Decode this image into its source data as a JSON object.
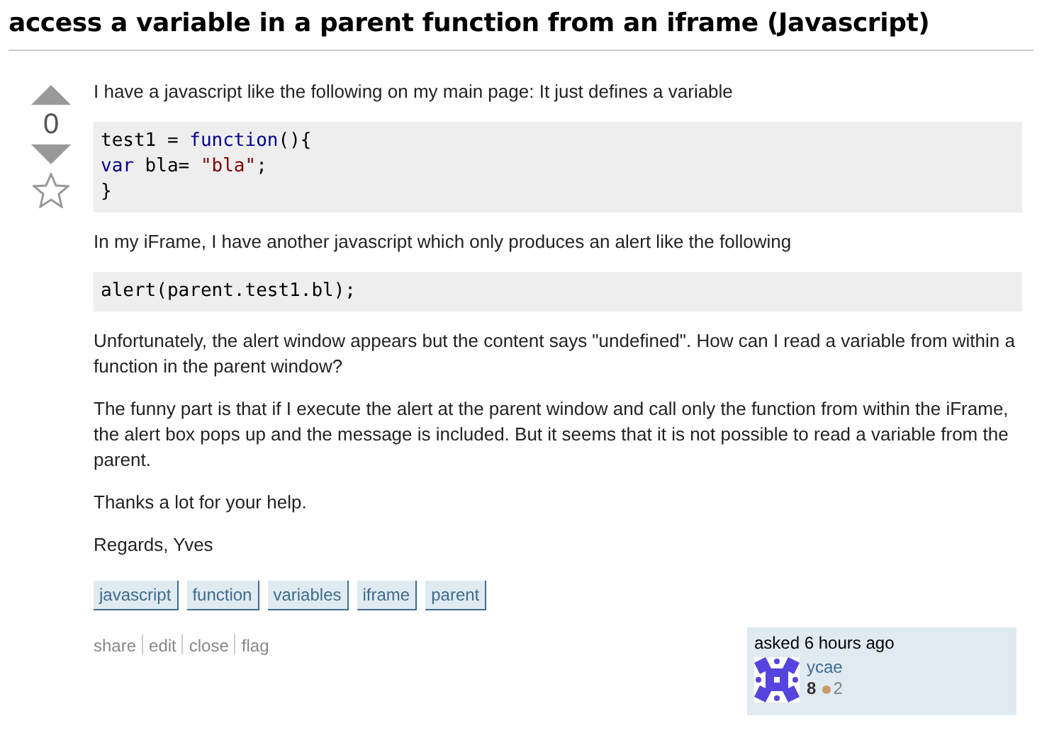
{
  "question": {
    "title": "access a variable in a parent function from an iframe (Javascript)",
    "votes": {
      "score": "0",
      "favorited": false
    },
    "body": [
      {
        "kind": "text",
        "text": "I have a javascript like the following on my main page: It just defines a variable"
      },
      {
        "kind": "code",
        "lines": [
          [
            {
              "text": "test1 = ",
              "kind": "plain"
            },
            {
              "text": "function",
              "kind": "keyword"
            },
            {
              "text": "(){",
              "kind": "plain"
            }
          ],
          [
            {
              "text": "var",
              "kind": "keyword"
            },
            {
              "text": " bla= ",
              "kind": "plain"
            },
            {
              "text": "\"bla\"",
              "kind": "string"
            },
            {
              "text": ";",
              "kind": "plain"
            }
          ],
          [
            {
              "text": "}",
              "kind": "plain"
            }
          ]
        ]
      },
      {
        "kind": "text",
        "text": "In my iFrame, I have another javascript which only produces an alert like the following"
      },
      {
        "kind": "code",
        "lines": [
          [
            {
              "text": "alert(parent.test1.bl);",
              "kind": "plain"
            }
          ]
        ]
      },
      {
        "kind": "text",
        "text": "Unfortunately, the alert window appears but the content says \"undefined\". How can I read a variable from within a function in the parent window?"
      },
      {
        "kind": "text",
        "text": "The funny part is that if I execute the alert at the parent window and call only the function from within the iFrame, the alert box pops up and the message is included. But it seems that it is not possible to read a variable from the parent."
      },
      {
        "kind": "text",
        "text": "Thanks a lot for your help."
      },
      {
        "kind": "text",
        "text": "Regards, Yves"
      }
    ],
    "tags": [
      "javascript",
      "function",
      "variables",
      "iframe",
      "parent"
    ],
    "actions": [
      "share",
      "edit",
      "close",
      "flag"
    ],
    "asked": {
      "label": "asked 6 hours ago",
      "user": "ycae",
      "reputation": "8",
      "badges": [
        {
          "kind": "bronze",
          "count": "2"
        }
      ]
    }
  }
}
